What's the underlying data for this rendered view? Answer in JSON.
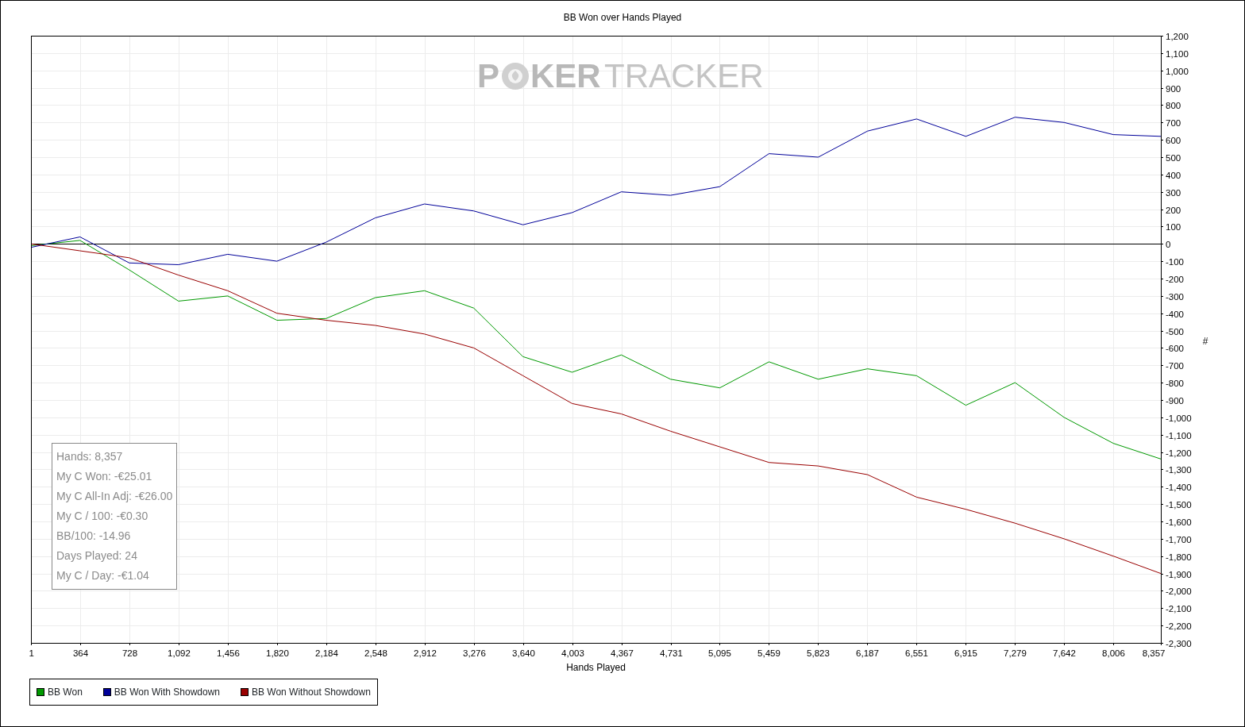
{
  "chart": {
    "watermark": {
      "parts": [
        "P",
        "KER",
        "TRACKER"
      ]
    },
    "chart_data": {
      "type": "line",
      "grid": true,
      "title": "BB Won over Hands Played",
      "xlabel": "Hands Played",
      "ylabel": "#",
      "x": [
        1,
        364,
        728,
        1092,
        1456,
        1820,
        2184,
        2548,
        2912,
        3276,
        3640,
        4003,
        4367,
        4731,
        5095,
        5459,
        5823,
        6187,
        6551,
        6915,
        7279,
        7642,
        8006,
        8357
      ],
      "series": [
        {
          "name": "BB Won",
          "color": "#009900",
          "values": [
            -10,
            20,
            -150,
            -330,
            -300,
            -440,
            -430,
            -310,
            -270,
            -370,
            -650,
            -740,
            -640,
            -780,
            -830,
            -680,
            -780,
            -720,
            -760,
            -930,
            -800,
            -1000,
            -1150,
            -1240
          ]
        },
        {
          "name": "BB Won With Showdown",
          "color": "#000099",
          "values": [
            -20,
            40,
            -110,
            -120,
            -60,
            -100,
            10,
            150,
            230,
            190,
            110,
            180,
            300,
            280,
            330,
            520,
            500,
            650,
            720,
            620,
            730,
            700,
            630,
            620
          ]
        },
        {
          "name": "BB Won Without Showdown",
          "color": "#990000",
          "values": [
            0,
            -40,
            -80,
            -180,
            -270,
            -400,
            -440,
            -470,
            -520,
            -600,
            -760,
            -920,
            -980,
            -1080,
            -1170,
            -1260,
            -1280,
            -1330,
            -1460,
            -1530,
            -1610,
            -1700,
            -1800,
            -1900
          ]
        }
      ],
      "xlim": [
        1,
        8357
      ],
      "ylim": [
        -2300,
        1200
      ],
      "xticks": [
        {
          "value": 1,
          "label": "1"
        },
        {
          "value": 364,
          "label": "364"
        },
        {
          "value": 728,
          "label": "728"
        },
        {
          "value": 1092,
          "label": "1,092"
        },
        {
          "value": 1456,
          "label": "1,456"
        },
        {
          "value": 1820,
          "label": "1,820"
        },
        {
          "value": 2184,
          "label": "2,184"
        },
        {
          "value": 2548,
          "label": "2,548"
        },
        {
          "value": 2912,
          "label": "2,912"
        },
        {
          "value": 3276,
          "label": "3,276"
        },
        {
          "value": 3640,
          "label": "3,640"
        },
        {
          "value": 4003,
          "label": "4,003"
        },
        {
          "value": 4367,
          "label": "4,367"
        },
        {
          "value": 4731,
          "label": "4,731"
        },
        {
          "value": 5095,
          "label": "5,095"
        },
        {
          "value": 5459,
          "label": "5,459"
        },
        {
          "value": 5823,
          "label": "5,823"
        },
        {
          "value": 6187,
          "label": "6,187"
        },
        {
          "value": 6551,
          "label": "6,551"
        },
        {
          "value": 6915,
          "label": "6,915"
        },
        {
          "value": 7279,
          "label": "7,279"
        },
        {
          "value": 7642,
          "label": "7,642"
        },
        {
          "value": 8006,
          "label": "8,006"
        },
        {
          "value": 8357,
          "label": "8,357"
        }
      ],
      "yticks": [
        {
          "value": 1200,
          "label": "1,200"
        },
        {
          "value": 1100,
          "label": "1,100"
        },
        {
          "value": 1000,
          "label": "1,000"
        },
        {
          "value": 900,
          "label": "900"
        },
        {
          "value": 800,
          "label": "800"
        },
        {
          "value": 700,
          "label": "700"
        },
        {
          "value": 600,
          "label": "600"
        },
        {
          "value": 500,
          "label": "500"
        },
        {
          "value": 400,
          "label": "400"
        },
        {
          "value": 300,
          "label": "300"
        },
        {
          "value": 200,
          "label": "200"
        },
        {
          "value": 100,
          "label": "100"
        },
        {
          "value": 0,
          "label": "0"
        },
        {
          "value": -100,
          "label": "-100"
        },
        {
          "value": -200,
          "label": "-200"
        },
        {
          "value": -300,
          "label": "-300"
        },
        {
          "value": -400,
          "label": "-400"
        },
        {
          "value": -500,
          "label": "-500"
        },
        {
          "value": -600,
          "label": "-600"
        },
        {
          "value": -700,
          "label": "-700"
        },
        {
          "value": -800,
          "label": "-800"
        },
        {
          "value": -900,
          "label": "-900"
        },
        {
          "value": -1000,
          "label": "-1,000"
        },
        {
          "value": -1100,
          "label": "-1,100"
        },
        {
          "value": -1200,
          "label": "-1,200"
        },
        {
          "value": -1300,
          "label": "-1,300"
        },
        {
          "value": -1400,
          "label": "-1,400"
        },
        {
          "value": -1500,
          "label": "-1,500"
        },
        {
          "value": -1600,
          "label": "-1,600"
        },
        {
          "value": -1700,
          "label": "-1,700"
        },
        {
          "value": -1800,
          "label": "-1,800"
        },
        {
          "value": -1900,
          "label": "-1,900"
        },
        {
          "value": -2000,
          "label": "-2,000"
        },
        {
          "value": -2100,
          "label": "-2,100"
        },
        {
          "value": -2200,
          "label": "-2,200"
        },
        {
          "value": -2300,
          "label": "-2,300"
        }
      ]
    },
    "stats": [
      "Hands: 8,357",
      "My C Won: -€25.01",
      "My C All-In Adj: -€26.00",
      "My C / 100: -€0.30",
      "BB/100: -14.96",
      "Days Played: 24",
      "My C / Day: -€1.04"
    ]
  }
}
